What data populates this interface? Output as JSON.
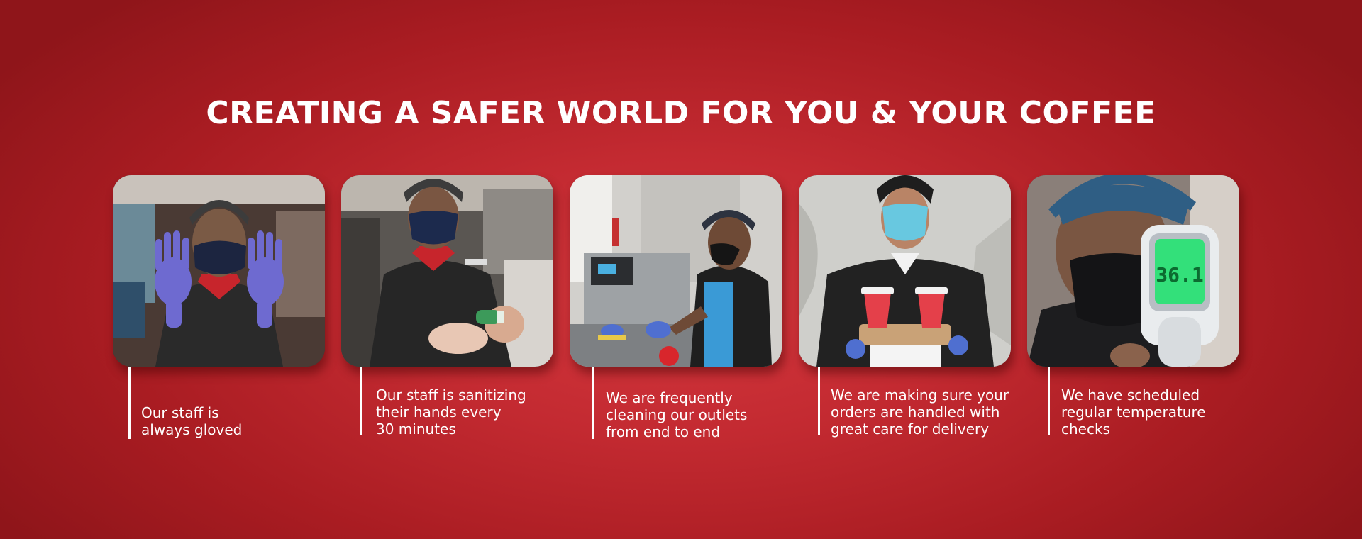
{
  "headline": "CREATING A SAFER WORLD FOR YOU & YOUR COFFEE",
  "colors": {
    "background_center": "#d4373d",
    "background_edge": "#8f151a",
    "text": "#ffffff"
  },
  "cards": [
    {
      "photo": "staff-gloved-hands-photo",
      "caption": "Our staff is\nalways gloved"
    },
    {
      "photo": "staff-sanitizing-hands-photo",
      "caption": "Our staff is sanitizing\ntheir hands every\n30 minutes"
    },
    {
      "photo": "staff-cleaning-outlet-photo",
      "caption": "We are frequently\ncleaning our outlets\nfrom end to end"
    },
    {
      "photo": "staff-holding-coffee-orders-photo",
      "caption": "We are making sure your\norders are handled with\ngreat care for delivery"
    },
    {
      "photo": "temperature-check-photo",
      "caption": "We have scheduled\nregular temperature\nchecks",
      "thermometer_reading": "36.1"
    }
  ]
}
